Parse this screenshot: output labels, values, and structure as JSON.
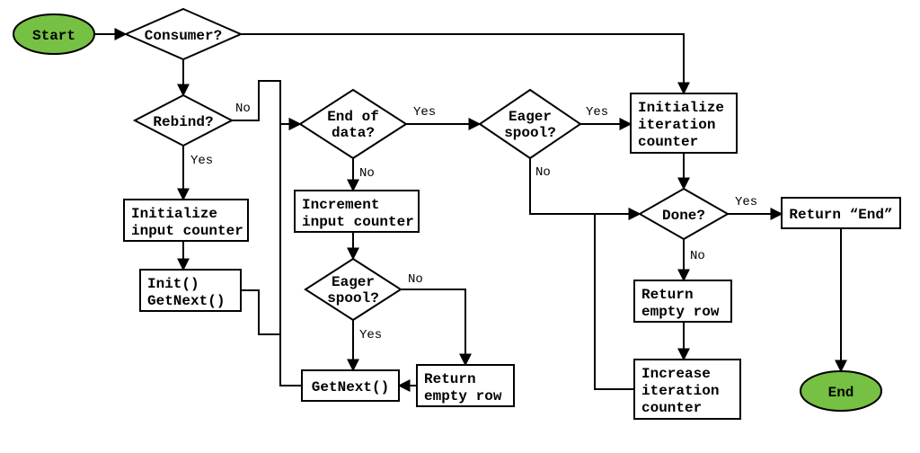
{
  "chart_data": {
    "type": "flowchart",
    "nodes": {
      "start": {
        "kind": "terminator",
        "label": "Start"
      },
      "consumer": {
        "kind": "decision",
        "label": "Consumer?"
      },
      "rebind": {
        "kind": "decision",
        "label": "Rebind?"
      },
      "init_input": {
        "kind": "process",
        "label1": "Initialize",
        "label2": "input counter"
      },
      "init_getnext": {
        "kind": "process",
        "label1": "Init()",
        "label2": "GetNext()"
      },
      "end_of_data": {
        "kind": "decision",
        "label1": "End of",
        "label2": "data?"
      },
      "incr_input": {
        "kind": "process",
        "label1": "Increment",
        "label2": "input counter"
      },
      "eager1": {
        "kind": "decision",
        "label1": "Eager",
        "label2": "spool?"
      },
      "getnext": {
        "kind": "process",
        "label": "GetNext()"
      },
      "ret_empty1": {
        "kind": "process",
        "label1": "Return",
        "label2": "empty row"
      },
      "eager2": {
        "kind": "decision",
        "label1": "Eager",
        "label2": "spool?"
      },
      "init_iter": {
        "kind": "process",
        "label1": "Initialize",
        "label2": "iteration",
        "label3": "counter"
      },
      "done": {
        "kind": "decision",
        "label": "Done?"
      },
      "ret_end": {
        "kind": "process",
        "label": "Return “End”"
      },
      "ret_empty2": {
        "kind": "process",
        "label1": "Return",
        "label2": "empty row"
      },
      "incr_iter": {
        "kind": "process",
        "label1": "Increase",
        "label2": "iteration",
        "label3": "counter"
      },
      "end": {
        "kind": "terminator",
        "label": "End"
      }
    },
    "edges": [
      {
        "from": "start",
        "to": "consumer"
      },
      {
        "from": "consumer",
        "to": "init_iter",
        "label": ""
      },
      {
        "from": "consumer",
        "to": "rebind"
      },
      {
        "from": "rebind",
        "to": "init_input",
        "label": "Yes"
      },
      {
        "from": "rebind",
        "to": "end_of_data",
        "label": "No"
      },
      {
        "from": "init_input",
        "to": "init_getnext"
      },
      {
        "from": "init_getnext",
        "to": "end_of_data"
      },
      {
        "from": "end_of_data",
        "to": "incr_input",
        "label": "No"
      },
      {
        "from": "end_of_data",
        "to": "eager2",
        "label": "Yes"
      },
      {
        "from": "incr_input",
        "to": "eager1"
      },
      {
        "from": "eager1",
        "to": "getnext",
        "label": "Yes"
      },
      {
        "from": "eager1",
        "to": "ret_empty1",
        "label": "No"
      },
      {
        "from": "ret_empty1",
        "to": "getnext"
      },
      {
        "from": "getnext",
        "to": "end_of_data"
      },
      {
        "from": "eager2",
        "to": "init_iter",
        "label": "Yes"
      },
      {
        "from": "eager2",
        "to": "done",
        "label": "No"
      },
      {
        "from": "init_iter",
        "to": "done"
      },
      {
        "from": "done",
        "to": "ret_end",
        "label": "Yes"
      },
      {
        "from": "done",
        "to": "ret_empty2",
        "label": "No"
      },
      {
        "from": "ret_empty2",
        "to": "incr_iter"
      },
      {
        "from": "incr_iter",
        "to": "done"
      },
      {
        "from": "ret_end",
        "to": "end"
      }
    ],
    "edge_labels": {
      "yes": "Yes",
      "no": "No"
    }
  }
}
